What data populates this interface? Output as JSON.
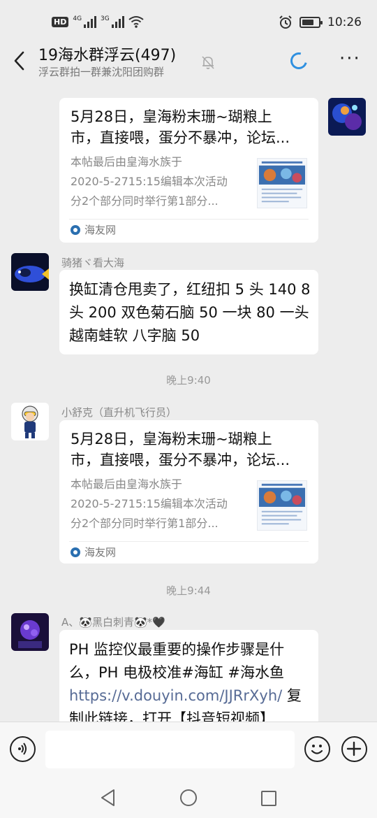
{
  "status_bar": {
    "hd": "HD",
    "sim1": "4G",
    "sim2": "3G",
    "time": "10:26"
  },
  "header": {
    "title": "19海水群浮云(497)",
    "subtitle": "浮云群拍一群兼沈阳团购群",
    "icons": [
      "back-arrow-icon",
      "mute-bell-icon",
      "loading-spinner-icon",
      "more-dots-icon"
    ]
  },
  "messages": [
    {
      "type": "card",
      "side": "right",
      "title": "5月28日，皇海粉末珊~瑚粮上市，直接喂，蛋分不暴冲，论坛...",
      "title_lines": [
        "5月28日，皇海粉末珊~瑚粮上",
        "市，直接喂，蛋分不暴冲，论坛..."
      ],
      "desc_lines": [
        "本帖最后由皇海水族于",
        "2020-5-2715:15编辑本次活动",
        "分2个部分同时举行第1部分..."
      ],
      "source": "海友网"
    },
    {
      "type": "text",
      "side": "left",
      "sender": "骑猪ヾ看大海",
      "text": "换缸清仓甩卖了，红纽扣 5 头 140 8 头 200 双色菊石脑 50 一块 80 一头 越南蛙软 八字脑 50",
      "lines": [
        "换缸清仓甩卖了，红纽扣 5 头 140 8",
        "头 200 双色菊石脑 50 一块 80 一头",
        "越南蛙软 八字脑 50"
      ]
    },
    {
      "type": "time",
      "text": "晚上9:40"
    },
    {
      "type": "card",
      "side": "left",
      "sender": "小舒克（直升机飞行员）",
      "title": "5月28日，皇海粉末珊~瑚粮上市，直接喂，蛋分不暴冲，论坛...",
      "title_lines": [
        "5月28日，皇海粉末珊~瑚粮上",
        "市，直接喂，蛋分不暴冲，论坛..."
      ],
      "desc_lines": [
        "本帖最后由皇海水族于",
        "2020-5-2715:15编辑本次活动",
        "分2个部分同时举行第1部分..."
      ],
      "source": "海友网"
    },
    {
      "type": "time",
      "text": "晚上9:44"
    },
    {
      "type": "text",
      "side": "left",
      "sender": "A、🐼黑白刺青🐼*🖤",
      "lines_plain": [
        "PH 监控仪最重要的操作步骤是什",
        "么，PH 电极校准#海缸 #海水鱼"
      ],
      "link": "https://v.douyin.com/JJRrXyh/",
      "link_suffix": " 复",
      "last_line": "制此链接，打开【抖音短视频】"
    }
  ],
  "input_bar": {
    "placeholder": "",
    "icons": [
      "voice-icon",
      "emoji-icon",
      "plus-icon"
    ]
  },
  "nav_bar": {
    "icons": [
      "nav-back-icon",
      "nav-home-icon",
      "nav-recent-icon"
    ]
  },
  "colors": {
    "background": "#ededed",
    "bubble": "#ffffff",
    "link": "#576b95",
    "spinner": "#2f90e0"
  }
}
